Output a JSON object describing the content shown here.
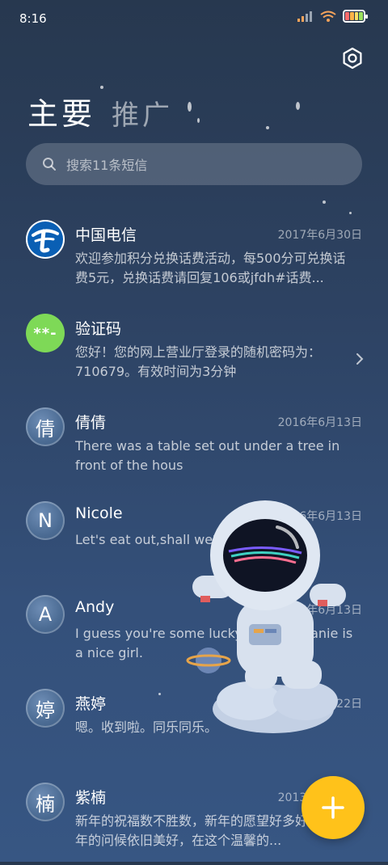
{
  "status_bar": {
    "time": "8:16",
    "battery_colors": [
      "#ff6b6b",
      "#ffb347",
      "#ffe066",
      "#9be15d"
    ]
  },
  "header": {
    "tabs": [
      {
        "label": "主要"
      },
      {
        "label": "推广"
      }
    ]
  },
  "search": {
    "placeholder": "搜索11条短信"
  },
  "messages": [
    {
      "name": "中国电信",
      "avatar": "telecom-logo",
      "date": "2017年6月30日",
      "preview": "欢迎参加积分兑换话费活动，每500分可兑换话费5元，兑换话费请回复106或jfdh#话费..."
    },
    {
      "name": "验证码",
      "avatar": "**-",
      "date": "",
      "preview": "您好！您的网上营业厅登录的随机密码为：710679。有效时间为3分钟"
    },
    {
      "name": "倩倩",
      "avatar": "倩",
      "date": "2016年6月13日",
      "preview": "There was a table set out under a tree in front of the hous"
    },
    {
      "name": "Nicole",
      "avatar": "N",
      "date": "2016年6月13日",
      "preview": "Let's eat out,shall we?"
    },
    {
      "name": "Andy",
      "avatar": "A",
      "date": "2016年6月13日",
      "preview": "I guess you're some lucky guy.Stephanie is a nice girl."
    },
    {
      "name": "燕婷",
      "avatar": "婷",
      "date": "2013年2月22日",
      "preview": "嗯。收到啦。同乐同乐。"
    },
    {
      "name": "紫楠",
      "avatar": "楠",
      "date": "2013年2月22日",
      "preview": "新年的祝福数不胜数，新年的愿望好多好多，新年的问候依旧美好，在这个温馨的..."
    }
  ],
  "colors": {
    "fab": "#ffc21a",
    "code_avatar": "#7ed957",
    "telecom_blue": "#0a5fb4"
  }
}
